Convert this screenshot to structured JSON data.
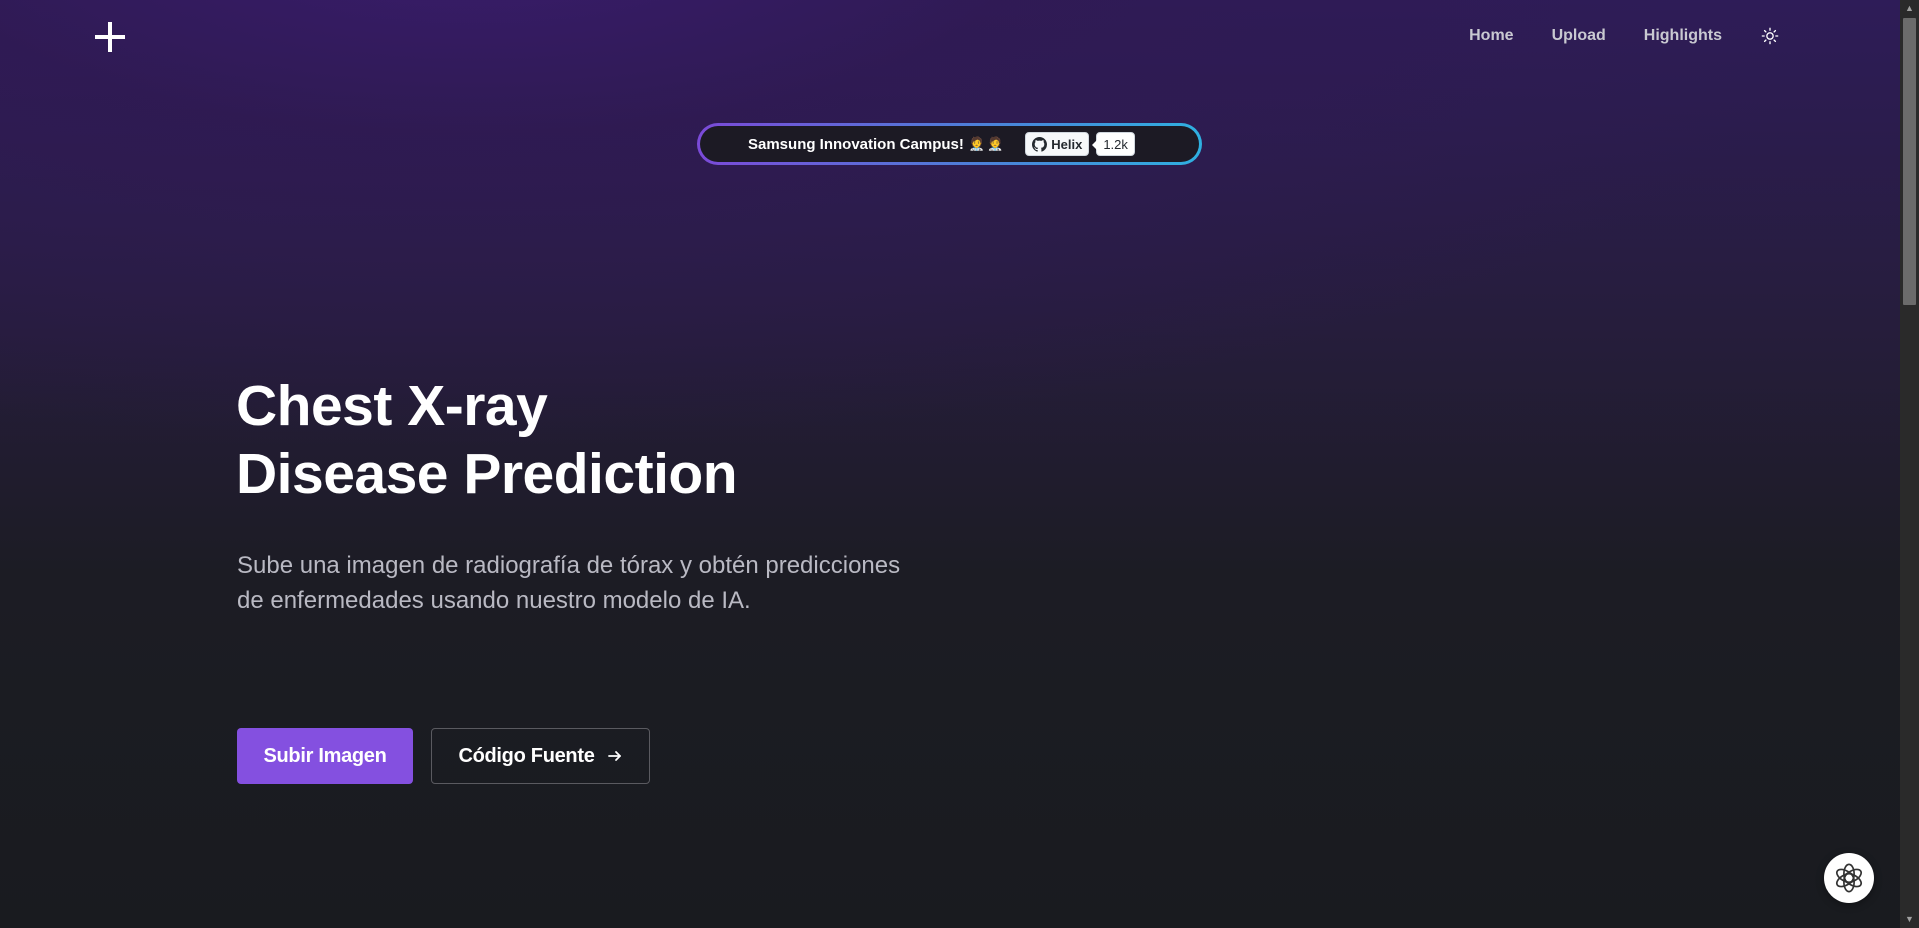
{
  "nav": {
    "items": [
      {
        "label": "Home"
      },
      {
        "label": "Upload"
      },
      {
        "label": "Highlights"
      }
    ],
    "theme_toggle_icon": "sun-icon"
  },
  "logo": {
    "icon": "plus-icon"
  },
  "announcement": {
    "text": "Samsung Innovation Campus!",
    "emoji": "🧑‍⚕️🧑‍⚕️",
    "github_label": "Helix",
    "github_count": "1.2k",
    "github_icon": "github-icon"
  },
  "hero": {
    "title_line1": "Chest X-ray",
    "title_line2": "Disease Prediction",
    "subtitle": "Sube una imagen de radiografía de tórax y obtén predicciones de enfermedades usando nuestro modelo de IA.",
    "primary_button": "Subir Imagen",
    "secondary_button": "Código Fuente",
    "secondary_button_icon": "arrow-right-icon"
  },
  "chat_fab": {
    "icon": "openai-icon"
  },
  "colors": {
    "accent": "#8450e0",
    "background": "#191b1f",
    "gradient_top": "#2e1c58"
  }
}
